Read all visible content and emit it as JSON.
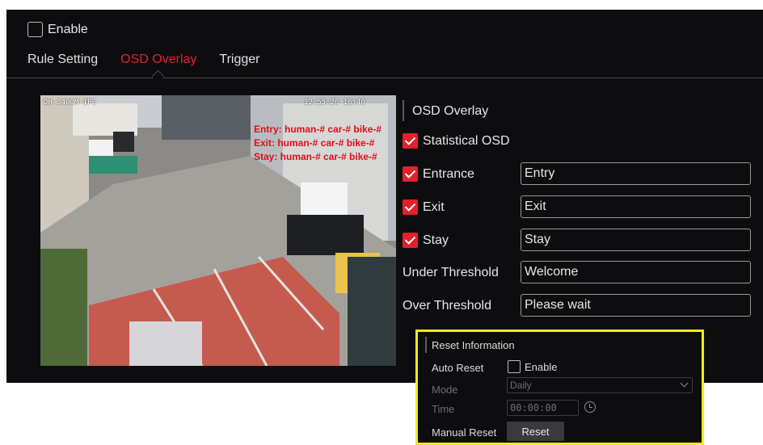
{
  "top": {
    "enable_label": "Enable",
    "enable_checked": false
  },
  "tabs": [
    {
      "label": "Rule Setting",
      "active": false
    },
    {
      "label": "OSD Overlay",
      "active": true
    },
    {
      "label": "Trigger",
      "active": false
    }
  ],
  "video": {
    "camera_name": "DH-3400M-IPC",
    "timestamp": "12:55:26 16:40",
    "osd_lines": [
      "Entry: human-# car-# bike-#",
      "Exit: human-# car-# bike-#",
      "Stay: human-# car-# bike-#"
    ]
  },
  "osd": {
    "section_title": "OSD Overlay",
    "statistical": {
      "label": "Statistical OSD",
      "checked": true
    },
    "entrance": {
      "label": "Entrance",
      "checked": true,
      "value": "Entry"
    },
    "exit": {
      "label": "Exit",
      "checked": true,
      "value": "Exit"
    },
    "stay": {
      "label": "Stay",
      "checked": true,
      "value": "Stay"
    },
    "under_threshold": {
      "label": "Under Threshold",
      "value": "Welcome"
    },
    "over_threshold": {
      "label": "Over Threshold",
      "value": "Please wait"
    }
  },
  "reset": {
    "title": "Reset Information",
    "auto_reset_label": "Auto Reset",
    "auto_enable_label": "Enable",
    "auto_enable_checked": false,
    "mode_label": "Mode",
    "mode_value": "Daily",
    "time_label": "Time",
    "time_value": "00:00:00",
    "manual_label": "Manual Reset",
    "button_label": "Reset"
  },
  "colors": {
    "accent": "#e4202a",
    "highlight_border": "#f4ec19",
    "background": "#0d0d0f"
  }
}
